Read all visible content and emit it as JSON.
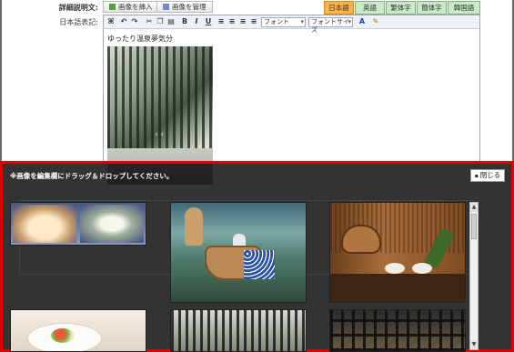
{
  "labels": {
    "details": "詳細説明文:",
    "japanese_notation": "日本語表記:"
  },
  "image_buttons": [
    {
      "label": "画像を挿入"
    },
    {
      "label": "画像を管理"
    }
  ],
  "language_tabs": [
    {
      "label": "日本語",
      "active": true
    },
    {
      "label": "英語"
    },
    {
      "label": "繁体字"
    },
    {
      "label": "簡体字"
    },
    {
      "label": "韓国語"
    }
  ],
  "toolbar": {
    "font_select": "フォント",
    "size_select": "フォントサイズ"
  },
  "editor": {
    "content_text": "ゆったり温泉夢気分"
  },
  "overlay": {
    "instruction": "※画像を編集欄にドラッグ＆ドロップしてください。",
    "close_label": "閉じる",
    "border_color": "#e00000"
  },
  "icons": [
    "image-insert-icon",
    "image-manage-icon",
    "close-icon",
    "scroll-up-arrow-icon",
    "scroll-down-arrow-icon"
  ],
  "colors": {
    "active_tab": "#ffb347",
    "inactive_tab": "#c8eac8",
    "overlay_bg": "rgba(0,0,0,0.80)"
  }
}
